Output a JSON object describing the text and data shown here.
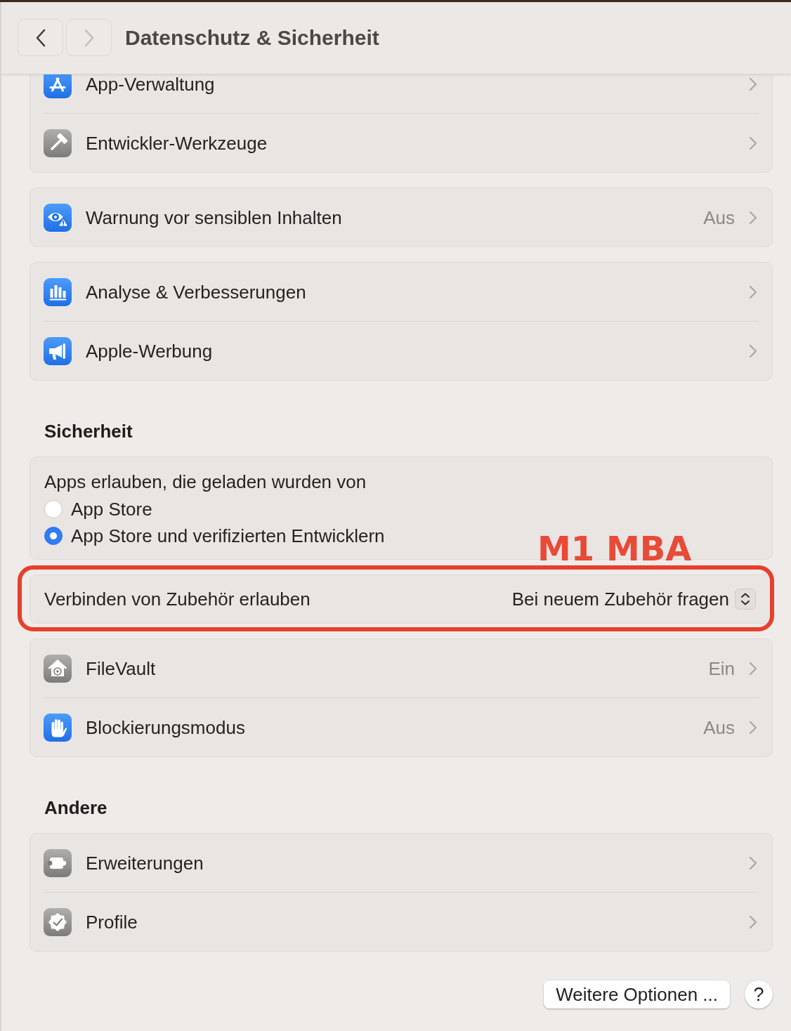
{
  "window": {
    "title": "Datenschutz & Sicherheit"
  },
  "nav_buttons": [
    {
      "kind": "back",
      "disabled": false
    },
    {
      "kind": "forward",
      "disabled": true
    }
  ],
  "sections": [
    {
      "groups": [
        {
          "kind": "list",
          "rows": [
            {
              "label": "App-Verwaltung"
            },
            {
              "label": "Entwickler-Werkzeuge"
            }
          ]
        },
        {
          "kind": "list",
          "rows": [
            {
              "label": "Warnung vor sensiblen Inhalten",
              "value": "Aus"
            }
          ]
        },
        {
          "kind": "list",
          "rows": [
            {
              "label": "Analyse & Verbesserungen"
            },
            {
              "label": "Apple-Werbung"
            }
          ]
        }
      ]
    },
    {
      "heading": "Sicherheit",
      "groups": [
        {
          "kind": "radio",
          "prompt": "Apps erlauben, die geladen wurden von",
          "options": [
            {
              "label": "App Store",
              "selected": false
            },
            {
              "label": "App Store und verifizierten Entwicklern",
              "selected": true
            }
          ]
        },
        {
          "kind": "popup",
          "label": "Verbinden von Zubehör erlauben",
          "value": "Bei neuem Zubehör fragen",
          "highlighted": true,
          "annotation": "M1 MBA"
        },
        {
          "kind": "list",
          "rows": [
            {
              "label": "FileVault",
              "value": "Ein"
            },
            {
              "label": "Blockierungsmodus",
              "value": "Aus"
            }
          ]
        }
      ]
    },
    {
      "heading": "Andere",
      "groups": [
        {
          "kind": "list",
          "rows": [
            {
              "label": "Erweiterungen"
            },
            {
              "label": "Profile"
            }
          ]
        }
      ]
    }
  ],
  "footer": {
    "buttons": [
      {
        "kind": "text",
        "label": "Weitere Optionen ..."
      },
      {
        "kind": "help",
        "label": "?"
      }
    ]
  }
}
